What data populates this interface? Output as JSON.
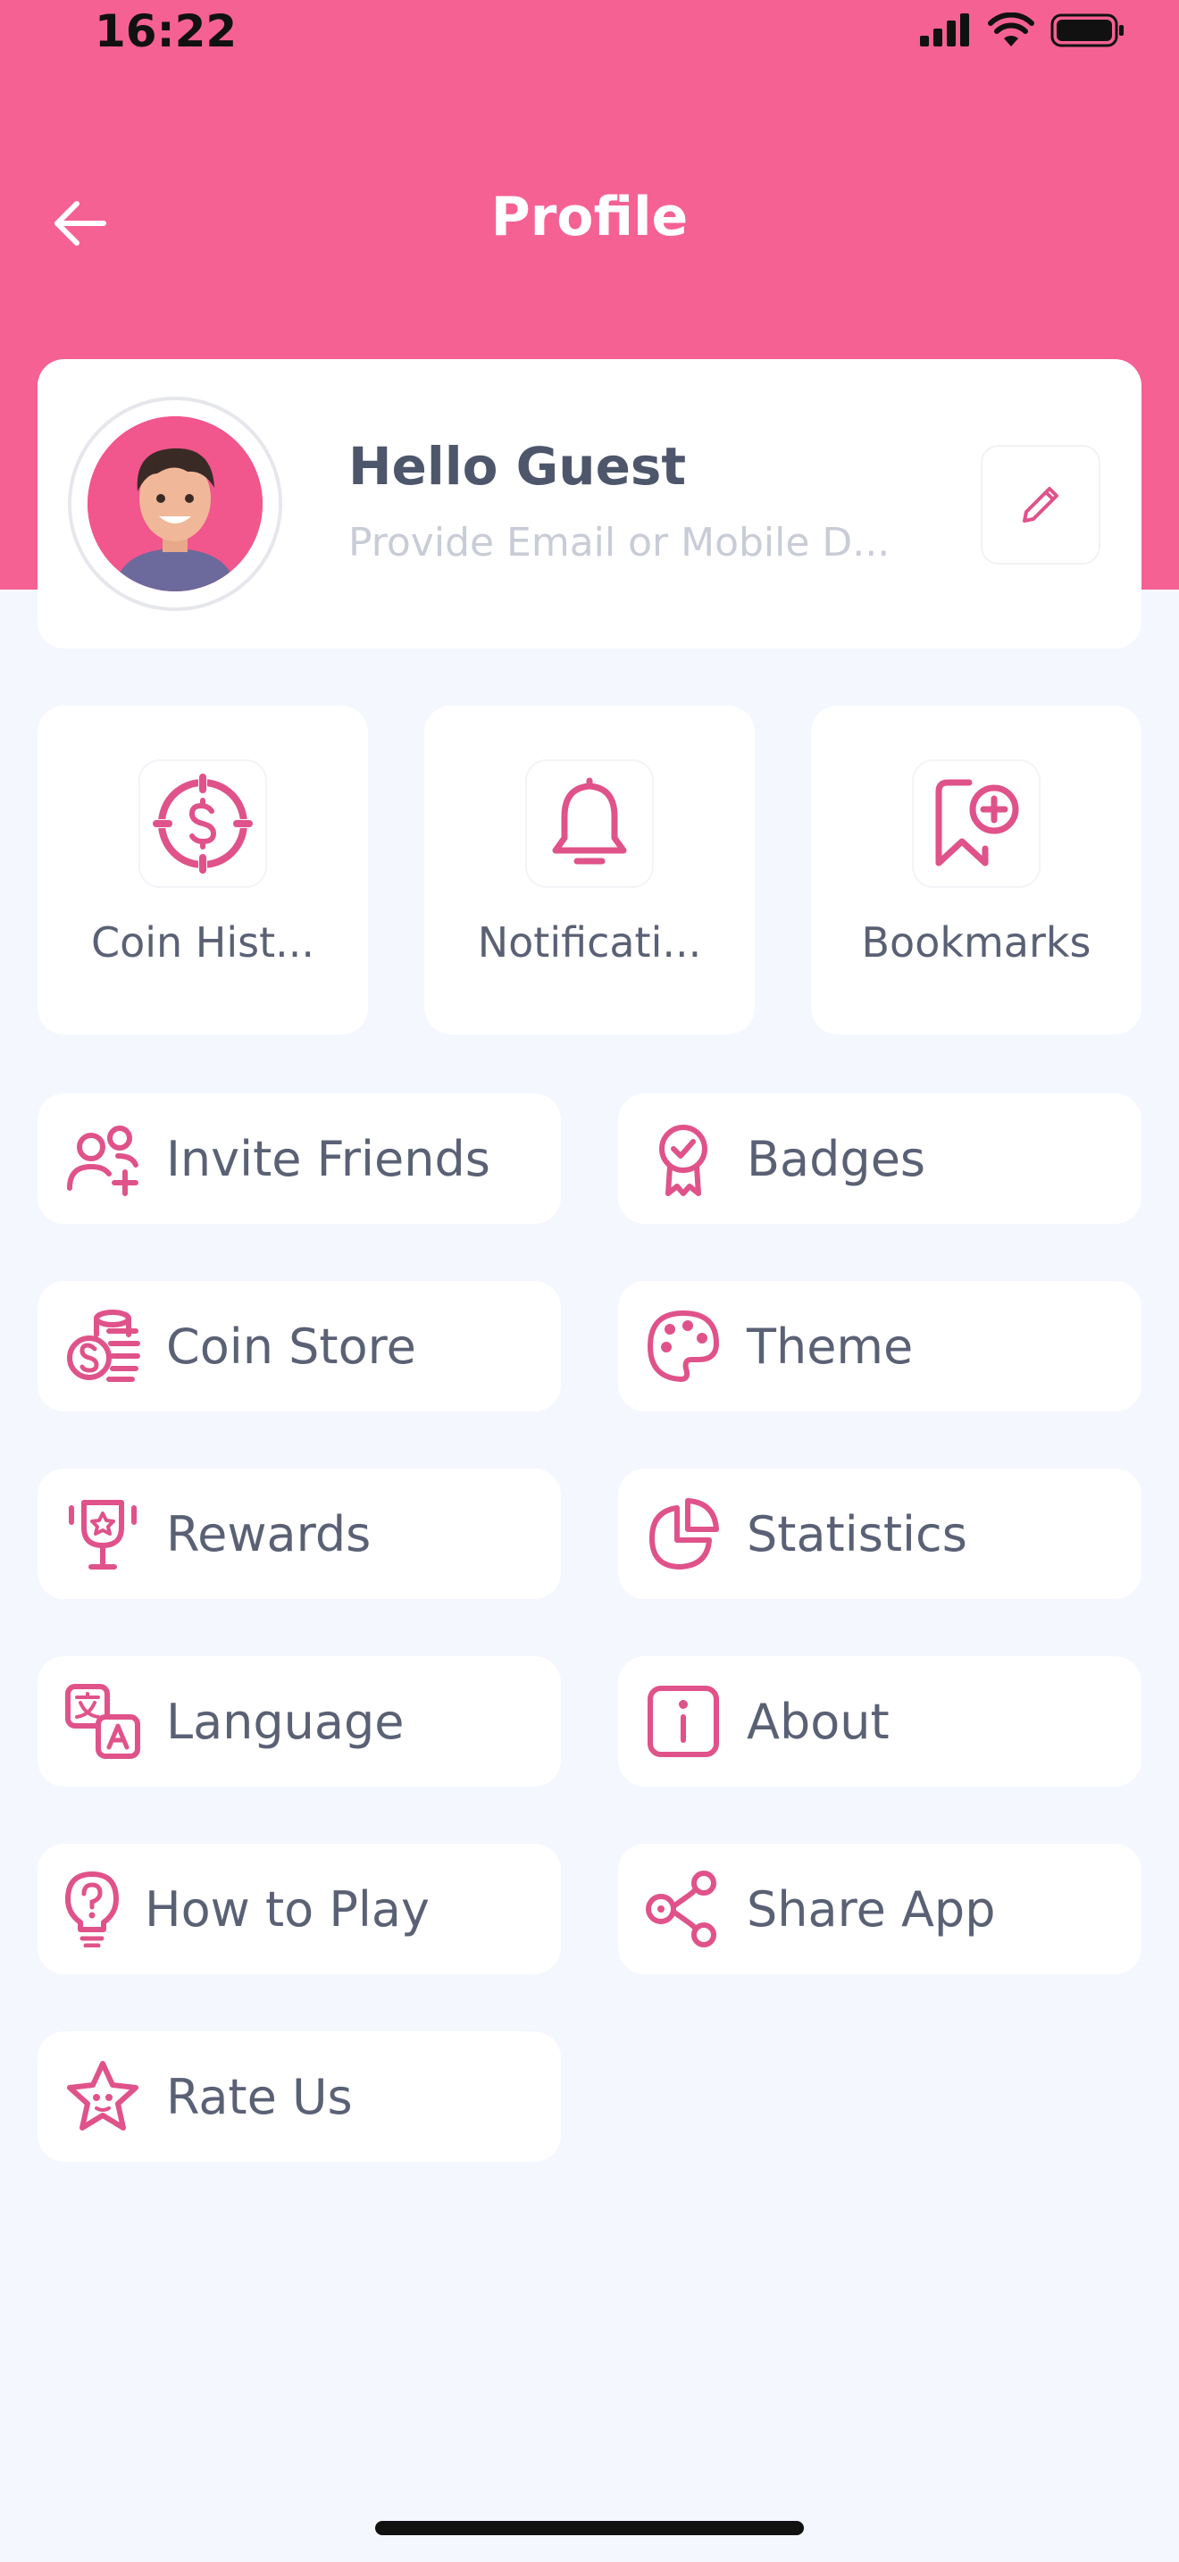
{
  "status_bar": {
    "time": "16:22"
  },
  "header": {
    "title": "Profile"
  },
  "profile": {
    "greeting": "Hello Guest",
    "subtitle": "Provide Email or Mobile D..."
  },
  "tiles": [
    {
      "label": "Coin Hist...",
      "icon": "coin-history-icon"
    },
    {
      "label": "Notificati...",
      "icon": "bell-icon"
    },
    {
      "label": "Bookmarks",
      "icon": "bookmark-add-icon"
    }
  ],
  "menu": [
    {
      "label": "Invite Friends",
      "icon": "invite-friends-icon"
    },
    {
      "label": "Badges",
      "icon": "badge-icon"
    },
    {
      "label": "Coin Store",
      "icon": "coin-store-icon"
    },
    {
      "label": "Theme",
      "icon": "palette-icon"
    },
    {
      "label": "Rewards",
      "icon": "trophy-icon"
    },
    {
      "label": "Statistics",
      "icon": "pie-chart-icon"
    },
    {
      "label": "Language",
      "icon": "translate-icon"
    },
    {
      "label": "About",
      "icon": "info-icon"
    },
    {
      "label": "How to Play",
      "icon": "lightbulb-question-icon"
    },
    {
      "label": "Share App",
      "icon": "share-icon"
    },
    {
      "label": "Rate Us",
      "icon": "star-icon"
    }
  ],
  "colors": {
    "accent": "#f56193",
    "icon": "#e0528a",
    "background": "#f4f7fd",
    "text": "#5a6175"
  }
}
